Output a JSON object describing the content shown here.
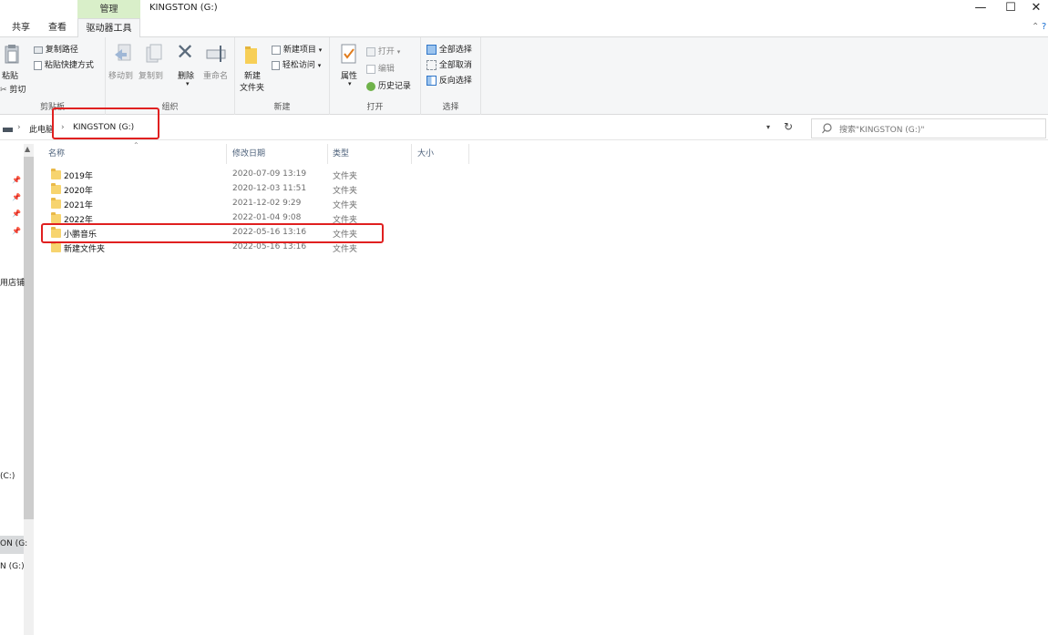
{
  "window": {
    "contextual_tab": "管理",
    "title": "KINGSTON (G:)",
    "minimize": "—",
    "maximize": "☐",
    "close": "✕"
  },
  "tabs": [
    "共享",
    "查看",
    "驱动器工具"
  ],
  "ribbon": {
    "clipboard": {
      "paste": "粘贴",
      "copy_path": "复制路径",
      "paste_shortcut": "粘贴快捷方式",
      "cut": "剪切",
      "label": "剪贴板"
    },
    "organize": {
      "move_to": "移动到",
      "copy_to": "复制到",
      "delete": "删除",
      "rename": "重命名",
      "label": "组织"
    },
    "new": {
      "new_folder_l1": "新建",
      "new_folder_l2": "文件夹",
      "new_item": "新建项目",
      "easy_access": "轻松访问",
      "label": "新建"
    },
    "open": {
      "properties": "属性",
      "open": "打开",
      "edit": "编辑",
      "history": "历史记录",
      "label": "打开"
    },
    "select": {
      "select_all": "全部选择",
      "select_none": "全部取消",
      "invert": "反向选择",
      "label": "选择"
    }
  },
  "address": {
    "crumbs": [
      "此电脑",
      "KINGSTON (G:)"
    ],
    "search_placeholder": "搜索\"KINGSTON (G:)\""
  },
  "nav": {
    "item1": "用店铺",
    "item2": "(C:)",
    "item3": "ON (G:",
    "item4": "N (G:)"
  },
  "columns": [
    "名称",
    "修改日期",
    "类型",
    "大小"
  ],
  "files": [
    {
      "name": "2019年",
      "date": "2020-07-09 13:19",
      "type": "文件夹"
    },
    {
      "name": "2020年",
      "date": "2020-12-03 11:51",
      "type": "文件夹"
    },
    {
      "name": "2021年",
      "date": "2021-12-02 9:29",
      "type": "文件夹"
    },
    {
      "name": "2022年",
      "date": "2022-01-04 9:08",
      "type": "文件夹"
    },
    {
      "name": "小鹏音乐",
      "date": "2022-05-16 13:16",
      "type": "文件夹"
    },
    {
      "name": "新建文件夹",
      "date": "2022-05-16 13:16",
      "type": "文件夹"
    }
  ],
  "colors": {
    "ribbon_bg": "#f5f6f7",
    "context_tab": "#d9efc9",
    "highlight_red": "#e02020",
    "folder_yellow": "#f7d46f"
  }
}
